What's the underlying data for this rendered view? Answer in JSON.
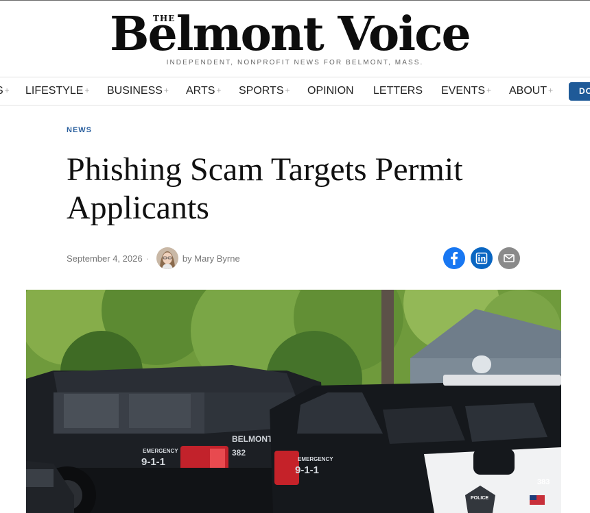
{
  "masthead": {
    "the": "THE",
    "name": "Belmont Voice",
    "tagline": "INDEPENDENT, NONPROFIT NEWS FOR BELMONT, MASS."
  },
  "nav": {
    "items": [
      {
        "label": "S",
        "has_submenu": true
      },
      {
        "label": "LIFESTYLE",
        "has_submenu": true
      },
      {
        "label": "BUSINESS",
        "has_submenu": true
      },
      {
        "label": "ARTS",
        "has_submenu": true
      },
      {
        "label": "SPORTS",
        "has_submenu": true
      },
      {
        "label": "OPINION",
        "has_submenu": false
      },
      {
        "label": "LETTERS",
        "has_submenu": false
      },
      {
        "label": "EVENTS",
        "has_submenu": true
      },
      {
        "label": "ABOUT",
        "has_submenu": true
      }
    ],
    "submenu_glyph": "+",
    "donate_label": "DO"
  },
  "article": {
    "category": "NEWS",
    "title": "Phishing Scam Targets Permit Applicants",
    "date": "September 4, 2026",
    "separator": "·",
    "byline": "by Mary Byrne"
  },
  "share": [
    {
      "icon": "facebook-icon",
      "color": "#1877f2"
    },
    {
      "icon": "linkedin-icon",
      "color": "#0a66c2"
    },
    {
      "icon": "email-icon",
      "color": "#8a8a8a"
    }
  ],
  "photo": {
    "car_left_text": "BELMONT",
    "car_left_number": "382",
    "car_right_number": "383",
    "emergency_label": "EMERGENCY",
    "emergency_number": "9-1-1",
    "badge_text": "POLICE"
  },
  "colors": {
    "accent": "#2a5f9e",
    "donate": "#1f5a98"
  }
}
